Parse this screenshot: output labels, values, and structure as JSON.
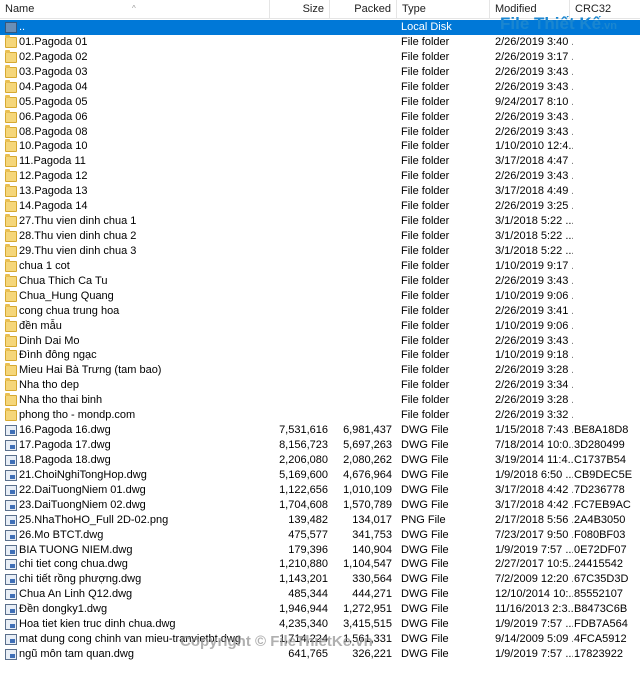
{
  "columns": {
    "name": "Name",
    "size": "Size",
    "packed": "Packed",
    "type": "Type",
    "modified": "Modified",
    "crc": "CRC32"
  },
  "rows": [
    {
      "icon": "up-folder-icon",
      "name": "..",
      "size": "",
      "packed": "",
      "type": "Local Disk",
      "modified": "",
      "crc": "",
      "selected": true
    },
    {
      "icon": "folder-icon",
      "name": "01.Pagoda 01",
      "size": "",
      "packed": "",
      "type": "File folder",
      "modified": "2/26/2019 3:40 ...",
      "crc": ""
    },
    {
      "icon": "folder-icon",
      "name": "02.Pagoda 02",
      "size": "",
      "packed": "",
      "type": "File folder",
      "modified": "2/26/2019 3:17 ...",
      "crc": ""
    },
    {
      "icon": "folder-icon",
      "name": "03.Pagoda 03",
      "size": "",
      "packed": "",
      "type": "File folder",
      "modified": "2/26/2019 3:43 ...",
      "crc": ""
    },
    {
      "icon": "folder-icon",
      "name": "04.Pagoda 04",
      "size": "",
      "packed": "",
      "type": "File folder",
      "modified": "2/26/2019 3:43 ...",
      "crc": ""
    },
    {
      "icon": "folder-icon",
      "name": "05.Pagoda 05",
      "size": "",
      "packed": "",
      "type": "File folder",
      "modified": "9/24/2017 8:10 ...",
      "crc": ""
    },
    {
      "icon": "folder-icon",
      "name": "06.Pagoda 06",
      "size": "",
      "packed": "",
      "type": "File folder",
      "modified": "2/26/2019 3:43 ...",
      "crc": ""
    },
    {
      "icon": "folder-icon",
      "name": "08.Pagoda 08",
      "size": "",
      "packed": "",
      "type": "File folder",
      "modified": "2/26/2019 3:43 ...",
      "crc": ""
    },
    {
      "icon": "folder-icon",
      "name": "10.Pagoda 10",
      "size": "",
      "packed": "",
      "type": "File folder",
      "modified": "1/10/2010 12:4...",
      "crc": ""
    },
    {
      "icon": "folder-icon",
      "name": "11.Pagoda 11",
      "size": "",
      "packed": "",
      "type": "File folder",
      "modified": "3/17/2018 4:47 ...",
      "crc": ""
    },
    {
      "icon": "folder-icon",
      "name": "12.Pagoda 12",
      "size": "",
      "packed": "",
      "type": "File folder",
      "modified": "2/26/2019 3:43 ...",
      "crc": ""
    },
    {
      "icon": "folder-icon",
      "name": "13.Pagoda 13",
      "size": "",
      "packed": "",
      "type": "File folder",
      "modified": "3/17/2018 4:49 ...",
      "crc": ""
    },
    {
      "icon": "folder-icon",
      "name": "14.Pagoda 14",
      "size": "",
      "packed": "",
      "type": "File folder",
      "modified": "2/26/2019 3:25 ...",
      "crc": ""
    },
    {
      "icon": "folder-icon",
      "name": "27.Thu vien dinh chua 1",
      "size": "",
      "packed": "",
      "type": "File folder",
      "modified": "3/1/2018 5:22 ...",
      "crc": ""
    },
    {
      "icon": "folder-icon",
      "name": "28.Thu vien dinh chua 2",
      "size": "",
      "packed": "",
      "type": "File folder",
      "modified": "3/1/2018 5:22 ...",
      "crc": ""
    },
    {
      "icon": "folder-icon",
      "name": "29.Thu vien dinh chua 3",
      "size": "",
      "packed": "",
      "type": "File folder",
      "modified": "3/1/2018 5:22 ...",
      "crc": ""
    },
    {
      "icon": "folder-icon",
      "name": "chua 1 cot",
      "size": "",
      "packed": "",
      "type": "File folder",
      "modified": "1/10/2019 9:17 ...",
      "crc": ""
    },
    {
      "icon": "folder-icon",
      "name": "Chua Thich Ca Tu",
      "size": "",
      "packed": "",
      "type": "File folder",
      "modified": "2/26/2019 3:43 ...",
      "crc": ""
    },
    {
      "icon": "folder-icon",
      "name": "Chua_Hung Quang",
      "size": "",
      "packed": "",
      "type": "File folder",
      "modified": "1/10/2019 9:06 ...",
      "crc": ""
    },
    {
      "icon": "folder-icon",
      "name": "cong chua trung hoa",
      "size": "",
      "packed": "",
      "type": "File folder",
      "modified": "2/26/2019 3:41 ...",
      "crc": ""
    },
    {
      "icon": "folder-icon",
      "name": "đền mẫu",
      "size": "",
      "packed": "",
      "type": "File folder",
      "modified": "1/10/2019 9:06 ...",
      "crc": ""
    },
    {
      "icon": "folder-icon",
      "name": "Dinh Dai Mo",
      "size": "",
      "packed": "",
      "type": "File folder",
      "modified": "2/26/2019 3:43 ...",
      "crc": ""
    },
    {
      "icon": "folder-icon",
      "name": "Đình đông ngạc",
      "size": "",
      "packed": "",
      "type": "File folder",
      "modified": "1/10/2019 9:18 ...",
      "crc": ""
    },
    {
      "icon": "folder-icon",
      "name": "Mieu Hai Bà Trưng (tam bao)",
      "size": "",
      "packed": "",
      "type": "File folder",
      "modified": "2/26/2019 3:28 ...",
      "crc": ""
    },
    {
      "icon": "folder-icon",
      "name": "Nha tho dep",
      "size": "",
      "packed": "",
      "type": "File folder",
      "modified": "2/26/2019 3:34 ...",
      "crc": ""
    },
    {
      "icon": "folder-icon",
      "name": "Nha tho thai binh",
      "size": "",
      "packed": "",
      "type": "File folder",
      "modified": "2/26/2019 3:28 ...",
      "crc": ""
    },
    {
      "icon": "folder-icon",
      "name": "phong tho - mondp.com",
      "size": "",
      "packed": "",
      "type": "File folder",
      "modified": "2/26/2019 3:32 ...",
      "crc": ""
    },
    {
      "icon": "dwg-file-icon",
      "name": "16.Pagoda 16.dwg",
      "size": "7,531,616",
      "packed": "6,981,437",
      "type": "DWG File",
      "modified": "1/15/2018 7:43 ...",
      "crc": "BE8A18D8"
    },
    {
      "icon": "dwg-file-icon",
      "name": "17.Pagoda 17.dwg",
      "size": "8,156,723",
      "packed": "5,697,263",
      "type": "DWG File",
      "modified": "7/18/2014 10:0...",
      "crc": "3D280499"
    },
    {
      "icon": "dwg-file-icon",
      "name": "18.Pagoda 18.dwg",
      "size": "2,206,080",
      "packed": "2,080,262",
      "type": "DWG File",
      "modified": "3/19/2014 11:4...",
      "crc": "C1737B54"
    },
    {
      "icon": "dwg-file-icon",
      "name": "21.ChoiNghiTongHop.dwg",
      "size": "5,169,600",
      "packed": "4,676,964",
      "type": "DWG File",
      "modified": "1/9/2018 6:50 ...",
      "crc": "CB9DEC5E"
    },
    {
      "icon": "dwg-file-icon",
      "name": "22.DaiTuongNiem 01.dwg",
      "size": "1,122,656",
      "packed": "1,010,109",
      "type": "DWG File",
      "modified": "3/17/2018 4:42 ...",
      "crc": "7D236778"
    },
    {
      "icon": "dwg-file-icon",
      "name": "23.DaiTuongNiem 02.dwg",
      "size": "1,704,608",
      "packed": "1,570,789",
      "type": "DWG File",
      "modified": "3/17/2018 4:42 ...",
      "crc": "FC7EB9AC"
    },
    {
      "icon": "png-file-icon",
      "name": "25.NhaThoHO_Full 2D-02.png",
      "size": "139,482",
      "packed": "134,017",
      "type": "PNG File",
      "modified": "2/17/2018 5:56 ...",
      "crc": "2A4B3050"
    },
    {
      "icon": "dwg-file-icon",
      "name": "26.Mo BTCT.dwg",
      "size": "475,577",
      "packed": "341,753",
      "type": "DWG File",
      "modified": "7/23/2017 9:50 ...",
      "crc": "F080BF03"
    },
    {
      "icon": "dwg-file-icon",
      "name": "BIA TUONG NIEM.dwg",
      "size": "179,396",
      "packed": "140,904",
      "type": "DWG File",
      "modified": "1/9/2019 7:57 ...",
      "crc": "0E72DF07"
    },
    {
      "icon": "dwg-file-icon",
      "name": "chi tiet cong chua.dwg",
      "size": "1,210,880",
      "packed": "1,104,547",
      "type": "DWG File",
      "modified": "2/27/2017 10:5...",
      "crc": "24415542"
    },
    {
      "icon": "dwg-file-icon",
      "name": "chi tiết rồng phượng.dwg",
      "size": "1,143,201",
      "packed": "330,564",
      "type": "DWG File",
      "modified": "7/2/2009 12:20 ...",
      "crc": "67C35D3D"
    },
    {
      "icon": "dwg-file-icon",
      "name": "Chua An Linh Q12.dwg",
      "size": "485,344",
      "packed": "444,271",
      "type": "DWG File",
      "modified": "12/10/2014 10:...",
      "crc": "85552107"
    },
    {
      "icon": "dwg-file-icon",
      "name": "Đền dongky1.dwg",
      "size": "1,946,944",
      "packed": "1,272,951",
      "type": "DWG File",
      "modified": "11/16/2013 2:3...",
      "crc": "B8473C6B"
    },
    {
      "icon": "dwg-file-icon",
      "name": "Hoa tiet kien truc dinh chua.dwg",
      "size": "4,235,340",
      "packed": "3,415,515",
      "type": "DWG File",
      "modified": "1/9/2019 7:57 ...",
      "crc": "FDB7A564"
    },
    {
      "icon": "dwg-file-icon",
      "name": "mat dung cong chinh van mieu-tranvietbt.dwg",
      "size": "1,714,224",
      "packed": "1,561,331",
      "type": "DWG File",
      "modified": "9/14/2009 5:09 ...",
      "crc": "4FCA5912"
    },
    {
      "icon": "dwg-file-icon",
      "name": "ngũ môn tam quan.dwg",
      "size": "641,765",
      "packed": "326,221",
      "type": "DWG File",
      "modified": "1/9/2019 7:57 ...",
      "crc": "17823922"
    }
  ],
  "watermark": {
    "brand": "File Thiết Kế",
    "ext": ".vn",
    "copyright": "Copyright © FileThietKe.vn"
  },
  "colors": {
    "selection": "#0078d7",
    "folder": "#f5d67a",
    "watermark": "#1a86d0"
  }
}
